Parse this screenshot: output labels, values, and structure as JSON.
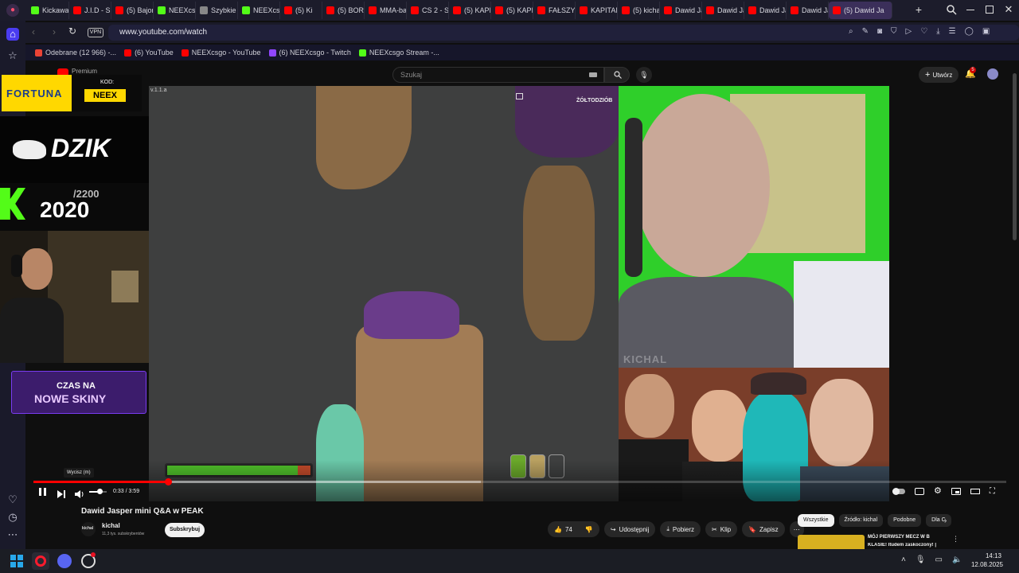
{
  "browser": {
    "tabs": [
      {
        "label": "Kickaway",
        "color": "#53fc18"
      },
      {
        "label": "J.I.D - Su",
        "color": "#ff0000"
      },
      {
        "label": "(5) Bajon",
        "color": "#ff0000"
      },
      {
        "label": "NEEXcsg",
        "color": "#53fc18"
      },
      {
        "label": "Szybkie w",
        "color": "#888888"
      },
      {
        "label": "NEEXcsg",
        "color": "#53fc18"
      },
      {
        "label": "(5) Ki",
        "color": "#ff0000"
      },
      {
        "label": "(5) BORB",
        "color": "#ff0000"
      },
      {
        "label": "MMA-ba",
        "color": "#ff0000"
      },
      {
        "label": "CS 2 - Sn",
        "color": "#ff0000"
      },
      {
        "label": "(5) KAPIT",
        "color": "#ff0000"
      },
      {
        "label": "(5) KAPIT",
        "color": "#ff0000"
      },
      {
        "label": "FAŁSZYW",
        "color": "#ff0000"
      },
      {
        "label": "KAPITAN",
        "color": "#ff0000"
      },
      {
        "label": "(5) kichal",
        "color": "#ff0000"
      },
      {
        "label": "Dawid Ja",
        "color": "#ff0000"
      },
      {
        "label": "Dawid Ja",
        "color": "#ff0000"
      },
      {
        "label": "Dawid Ja",
        "color": "#ff0000"
      },
      {
        "label": "Dawid Ja",
        "color": "#ff0000"
      },
      {
        "label": "(5) Dawid Ja",
        "color": "#ff0000"
      }
    ],
    "vpn_label": "VPN",
    "url": "www.youtube.com/watch",
    "bookmarks": [
      {
        "label": "Odebrane (12 966) -...",
        "color": "#ea4335"
      },
      {
        "label": "(6) YouTube",
        "color": "#ff0000"
      },
      {
        "label": "NEEXcsgo - YouTube",
        "color": "#ff0000"
      },
      {
        "label": "(6) NEEXcsgo - Twitch",
        "color": "#9146ff"
      },
      {
        "label": "NEEXcsgo Stream -...",
        "color": "#53fc18"
      }
    ]
  },
  "youtube": {
    "search_placeholder": "Szukaj",
    "create_label": "Utwórz",
    "notif_count": "5",
    "logo_text": "Premium",
    "player": {
      "time": "0:33 / 3:59",
      "progress": 0.138,
      "buffered": 0.46,
      "tooltip": "Wycisz (m)",
      "volume": 0.6
    },
    "video_title": "Dawid Jasper mini Q&A w PEAK",
    "channel": {
      "name": "kichal",
      "subs": "11,3 tys. subskrybentów",
      "avatar_text": "kichal"
    },
    "subscribe_label": "Subskrybuj",
    "actions": {
      "likes": "74",
      "share": "Udostępnij",
      "download": "Pobierz",
      "clip": "Klip",
      "save": "Zapisz"
    },
    "chips": [
      "Wszystkie",
      "Źródło: kichal",
      "Podobne",
      "Dla C"
    ],
    "related_title": "MÓJ PIERWSZY MECZ W B",
    "related_subtitle": "KLASIE! Itudem zaskoczony! |"
  },
  "stream_overlay": {
    "fortuna": "FORTUNA",
    "kod_label": "KOD:",
    "kod_value": "NEEX",
    "dzik": "DZIK",
    "counter_total": "/2200",
    "counter_value": "2020",
    "czas_na": "CZAS NA",
    "nowe_skiny": "NOWE SKINY",
    "game_label": "ŻÓŁTODZIÓB",
    "version": "v.1.1.a",
    "watermark": "KICHAL"
  },
  "taskbar": {
    "time": "14:13",
    "date": "12.08.2025"
  }
}
